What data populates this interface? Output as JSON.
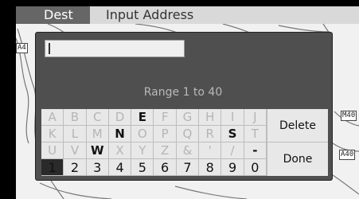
{
  "tabs": {
    "dest": "Dest",
    "input_address": "Input Address"
  },
  "map": {
    "road_labels": [
      "A4",
      "M40",
      "A40"
    ]
  },
  "dialog": {
    "input_value": "",
    "range_text": "Range 1 to 40"
  },
  "keyboard": {
    "rows": [
      [
        "A",
        "B",
        "C",
        "D",
        "E",
        "F",
        "G",
        "H",
        "I",
        "J"
      ],
      [
        "K",
        "L",
        "M",
        "N",
        "O",
        "P",
        "Q",
        "R",
        "S",
        "T"
      ],
      [
        "U",
        "V",
        "W",
        "X",
        "Y",
        "Z",
        "&",
        "'",
        "/",
        "-"
      ],
      [
        "1",
        "2",
        "3",
        "4",
        "5",
        "6",
        "7",
        "8",
        "9",
        "0"
      ]
    ],
    "enabled_keys": [
      "E",
      "N",
      "S",
      "W",
      "-",
      "1",
      "2",
      "3",
      "4",
      "5",
      "6",
      "7",
      "8",
      "9",
      "0"
    ],
    "selected_key": "1"
  },
  "actions": {
    "delete": "Delete",
    "done": "Done"
  }
}
